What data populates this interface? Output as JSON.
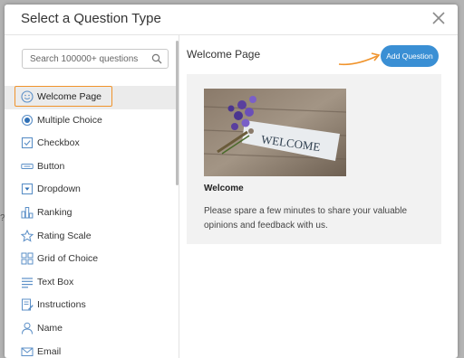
{
  "backdrop": {
    "glyph": "?"
  },
  "dialog": {
    "title": "Select a Question Type",
    "close_label": "×"
  },
  "search": {
    "placeholder": "Search 100000+ questions"
  },
  "question_types": [
    {
      "label": "Welcome Page",
      "icon": "smiley-icon",
      "selected": true
    },
    {
      "label": "Multiple Choice",
      "icon": "radio-icon"
    },
    {
      "label": "Checkbox",
      "icon": "checkbox-icon"
    },
    {
      "label": "Button",
      "icon": "button-icon"
    },
    {
      "label": "Dropdown",
      "icon": "dropdown-icon"
    },
    {
      "label": "Ranking",
      "icon": "ranking-icon"
    },
    {
      "label": "Rating Scale",
      "icon": "star-icon"
    },
    {
      "label": "Grid of Choice",
      "icon": "grid-icon"
    },
    {
      "label": "Text Box",
      "icon": "text-box-icon"
    },
    {
      "label": "Instructions",
      "icon": "instructions-icon"
    },
    {
      "label": "Name",
      "icon": "person-icon"
    },
    {
      "label": "Email",
      "icon": "email-icon"
    }
  ],
  "preview": {
    "title": "Welcome Page",
    "add_button_label": "Add Question",
    "image_tag_text": "WELCOME",
    "heading": "Welcome",
    "body": "Please spare a few minutes to share your valuable opinions and feedback with us."
  },
  "colors": {
    "accent": "#3a8fd4",
    "highlight": "#f0932b",
    "icon": "#5b8fc7"
  }
}
